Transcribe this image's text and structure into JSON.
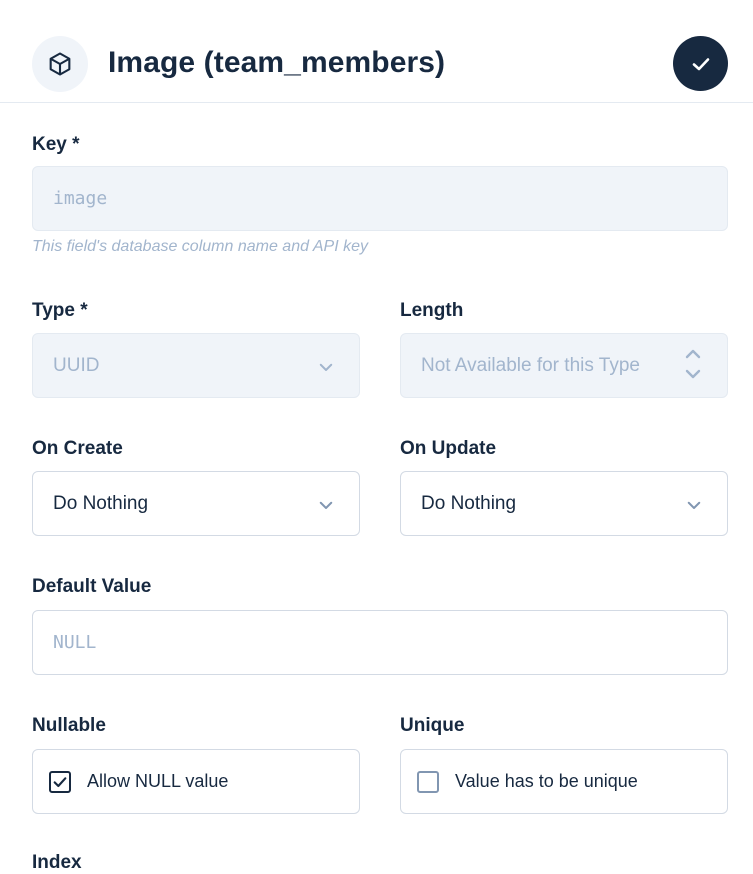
{
  "header": {
    "title": "Image (team_members)",
    "icon": "cube-icon",
    "save_icon": "check-icon"
  },
  "fields": {
    "key": {
      "label": "Key *",
      "value": "image",
      "hint": "This field's database column name and API key"
    },
    "type": {
      "label": "Type *",
      "value": "UUID"
    },
    "length": {
      "label": "Length",
      "value": "Not Available for this Type"
    },
    "on_create": {
      "label": "On Create",
      "value": "Do Nothing"
    },
    "on_update": {
      "label": "On Update",
      "value": "Do Nothing"
    },
    "default_value": {
      "label": "Default Value",
      "placeholder": "NULL"
    },
    "nullable": {
      "label": "Nullable",
      "checkbox_label": "Allow NULL value",
      "checked": true
    },
    "unique": {
      "label": "Unique",
      "checkbox_label": "Value has to be unique",
      "checked": false
    },
    "index": {
      "label": "Index"
    }
  },
  "colors": {
    "primary": "#172940",
    "muted": "#a2b5cd",
    "border": "#d3dae4",
    "disabled_bg": "#f0f4f9"
  }
}
